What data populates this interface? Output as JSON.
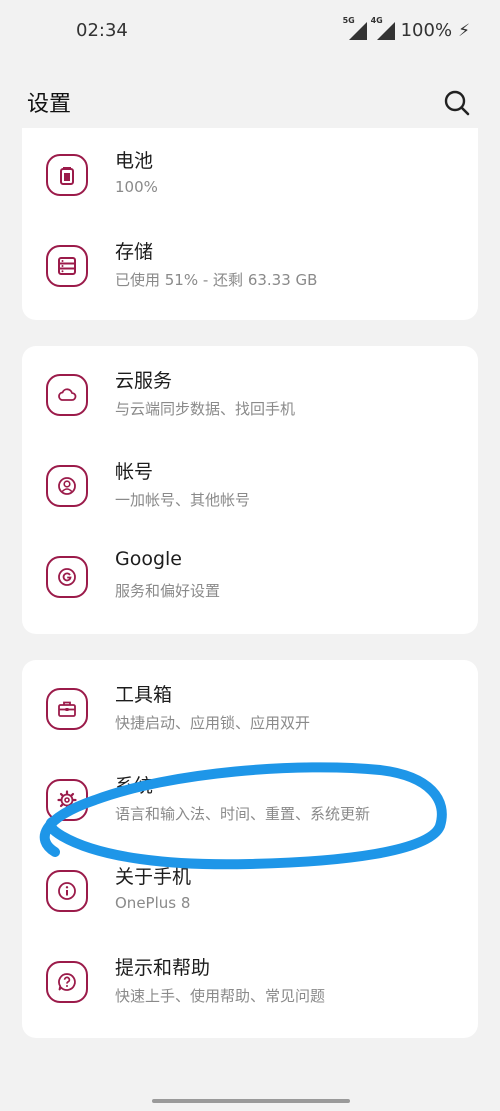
{
  "status_bar": {
    "time": "02:34",
    "signal1_label": "5G",
    "signal2_label": "4G",
    "battery": "100%"
  },
  "header": {
    "title": "设置",
    "search_icon": "search-icon"
  },
  "groups": [
    {
      "items": [
        {
          "title": "电池",
          "subtitle": "100%",
          "icon": "battery-icon"
        },
        {
          "title": "存储",
          "subtitle": "已使用 51% - 还剩 63.33 GB",
          "icon": "storage-icon"
        }
      ]
    },
    {
      "items": [
        {
          "title": "云服务",
          "subtitle": "与云端同步数据、找回手机",
          "icon": "cloud-icon"
        },
        {
          "title": "帐号",
          "subtitle": "一加帐号、其他帐号",
          "icon": "account-icon"
        },
        {
          "title": "Google",
          "subtitle": "服务和偏好设置",
          "icon": "google-icon"
        }
      ]
    },
    {
      "items": [
        {
          "title": "工具箱",
          "subtitle": "快捷启动、应用锁、应用双开",
          "icon": "toolbox-icon"
        },
        {
          "title": "系统",
          "subtitle": "语言和输入法、时间、重置、系统更新",
          "icon": "system-gear-icon"
        },
        {
          "title": "关于手机",
          "subtitle": "OnePlus 8",
          "icon": "info-icon"
        },
        {
          "title": "提示和帮助",
          "subtitle": "快速上手、使用帮助、常见问题",
          "icon": "help-icon"
        }
      ]
    }
  ],
  "colors": {
    "accent": "#9b1b4a",
    "annotation": "#1e96e8",
    "background": "#f2f2f2"
  }
}
